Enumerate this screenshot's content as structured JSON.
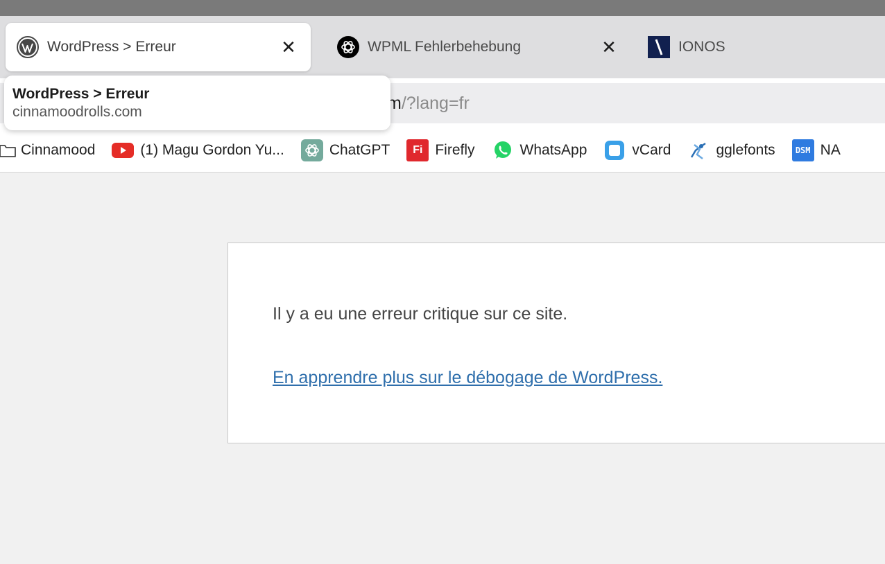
{
  "tabs": [
    {
      "title": "WordPress > Erreur",
      "icon": "wordpress-icon",
      "active": true,
      "close": "✕"
    },
    {
      "title": "WPML Fehlerbehebung",
      "icon": "openai-icon",
      "active": false,
      "close": "✕"
    },
    {
      "title": "IONOS",
      "icon": "ionos-icon",
      "active": false
    }
  ],
  "hovercard": {
    "title": "WordPress > Erreur",
    "domain": "cinnamoodrolls.com"
  },
  "omnibox": {
    "visible_host_tail": "m",
    "visible_path": "/?lang=fr"
  },
  "bookmarks": [
    {
      "label": "Cinnamood",
      "icon": "folder-icon"
    },
    {
      "label": "(1) Magu Gordon Yu...",
      "icon": "youtube-icon"
    },
    {
      "label": "ChatGPT",
      "icon": "chatgpt-icon"
    },
    {
      "label": "Firefly",
      "icon": "firefly-icon",
      "icon_text": "Fi"
    },
    {
      "label": "WhatsApp",
      "icon": "whatsapp-icon"
    },
    {
      "label": "vCard",
      "icon": "vcard-icon"
    },
    {
      "label": "gglefonts",
      "icon": "gglefonts-icon"
    },
    {
      "label": "NA",
      "icon": "dsm-icon",
      "icon_text": "DSM"
    }
  ],
  "page": {
    "error_message": "Il y a eu une erreur critique sur ce site.",
    "debug_link": "En apprendre plus sur le débogage de WordPress."
  },
  "colors": {
    "link": "#2f6fac",
    "youtube_red": "#e52d27",
    "firefly_red": "#e0282d",
    "whatsapp_green": "#25d366",
    "vcard_blue": "#3aa0e8",
    "dsm_blue": "#2f7be0",
    "ionos_navy": "#11204f"
  }
}
